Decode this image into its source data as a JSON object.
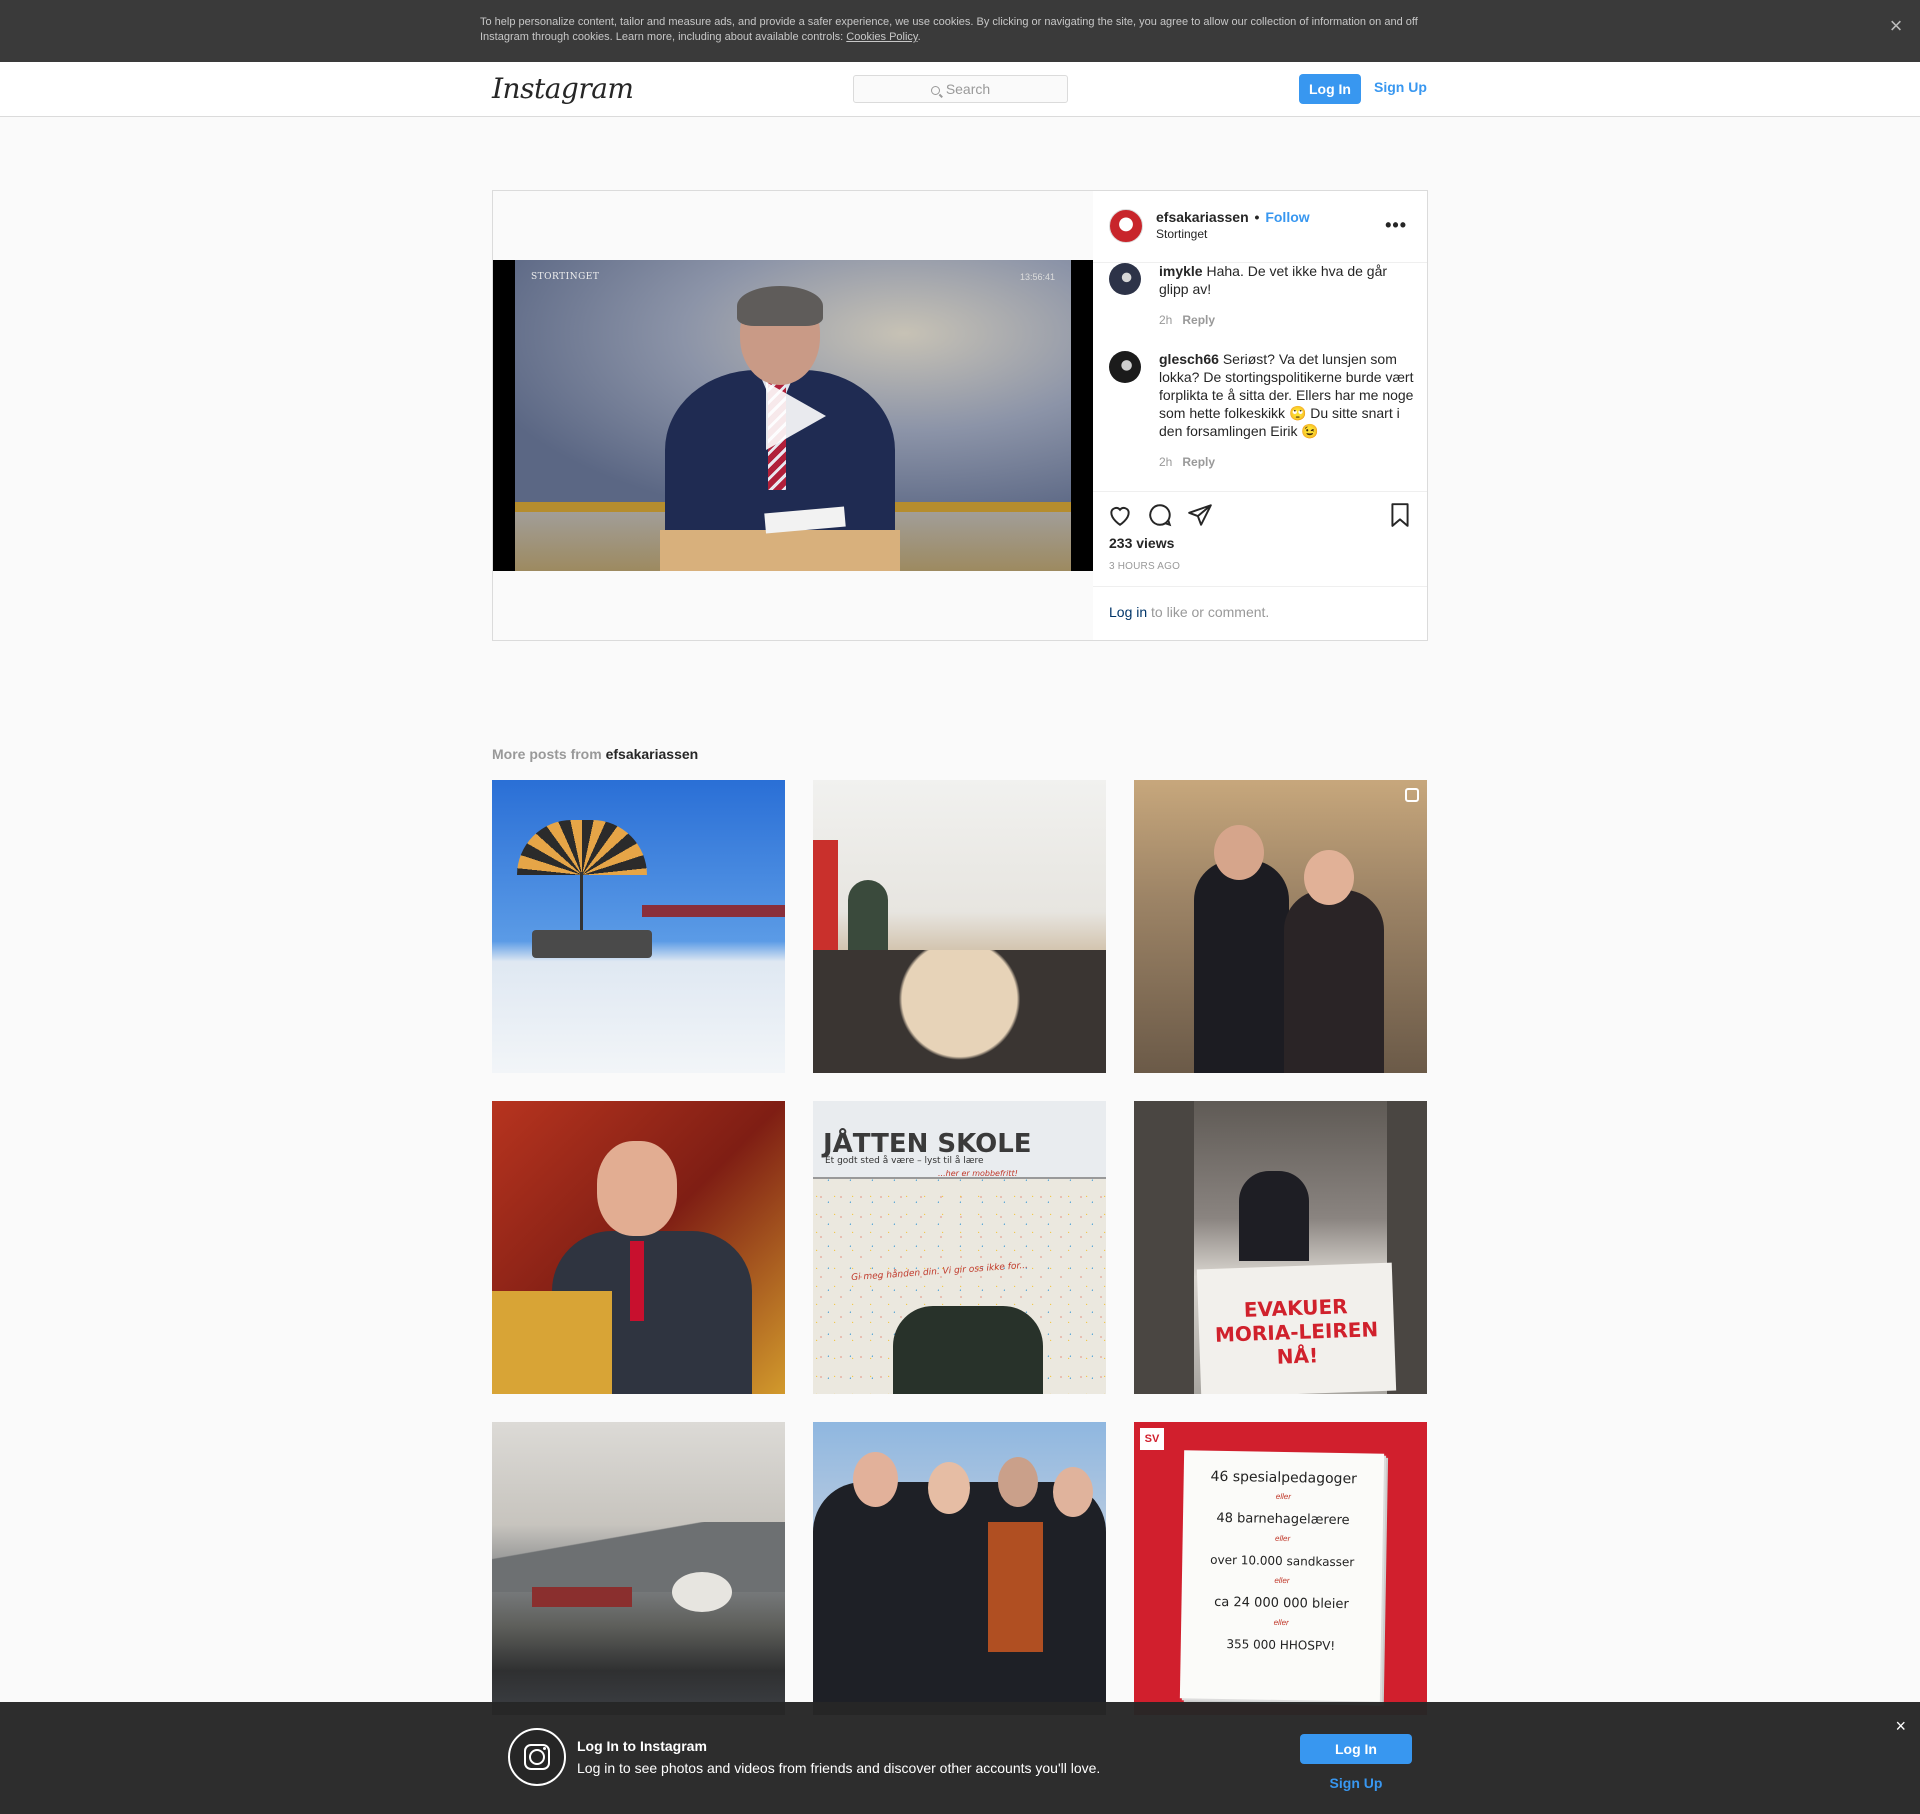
{
  "cookie_banner": {
    "text": "To help personalize content, tailor and measure ads, and provide a safer experience, we use cookies. By clicking or navigating the site, you agree to allow our collection of information on and off Instagram through cookies. Learn more, including about available controls:",
    "link": "Cookies Policy",
    "period": ".",
    "close": "×"
  },
  "nav": {
    "logo": "Instagram",
    "search_placeholder": "Search",
    "login": "Log In",
    "signup": "Sign Up"
  },
  "post": {
    "username": "efsakariassen",
    "separator": "•",
    "follow": "Follow",
    "location": "Stortinget",
    "more": "•••",
    "video_brand": "STORTINGET",
    "video_time": "13:56:41",
    "comments": [
      {
        "user": "imykle",
        "text": "Haha. De vet ikke hva de går glipp av!",
        "time": "2h",
        "reply": "Reply"
      },
      {
        "user": "glesch66",
        "text": "Seriøst? Va det lunsjen som lokka? De stortingspolitikerne burde vært forplikta te å sitta der. Ellers har me noge som hette folkeskikk 🙄  Du sitte snart i den forsamlingen Eirik 😉",
        "time": "2h",
        "reply": "Reply"
      }
    ],
    "views": "233 views",
    "ago": "3 HOURS AGO",
    "login_link": "Log in",
    "login_rest": " to like or comment."
  },
  "more_posts": {
    "prefix": "More posts from ",
    "username": "efsakariassen",
    "tiles": [
      {
        "alt": "umbrella-snow"
      },
      {
        "alt": "meeting-room"
      },
      {
        "alt": "two-people-hall"
      },
      {
        "alt": "man-parliament-seat"
      },
      {
        "alt": "jatten-skole",
        "sign_title": "JÅTTEN SKOLE",
        "sign_sub": "Et godt sted å være – lyst til å lære",
        "sign_tag": "...her er mobbefritt!",
        "wall_text": "Gi meg hånden din. Vi gir oss ikke for..."
      },
      {
        "alt": "evakuer-banner",
        "banner": "EVAKUER MORIA-LEIREN NÅ!"
      },
      {
        "alt": "fjord-winter"
      },
      {
        "alt": "four-people-outside"
      },
      {
        "alt": "sv-poster",
        "logo": "SV",
        "lines": [
          "46 spesialpedagoger",
          "eller",
          "48 barnehagelærere",
          "eller",
          "over 10.000 sandkasser",
          "eller",
          "ca 24 000 000 bleier",
          "eller",
          "355 000 HHOSPV!"
        ]
      }
    ]
  },
  "bottom_bar": {
    "title": "Log In to Instagram",
    "subtitle": "Log in to see photos and videos from friends and discover other accounts you'll love.",
    "login": "Log In",
    "signup": "Sign Up",
    "close": "×"
  }
}
